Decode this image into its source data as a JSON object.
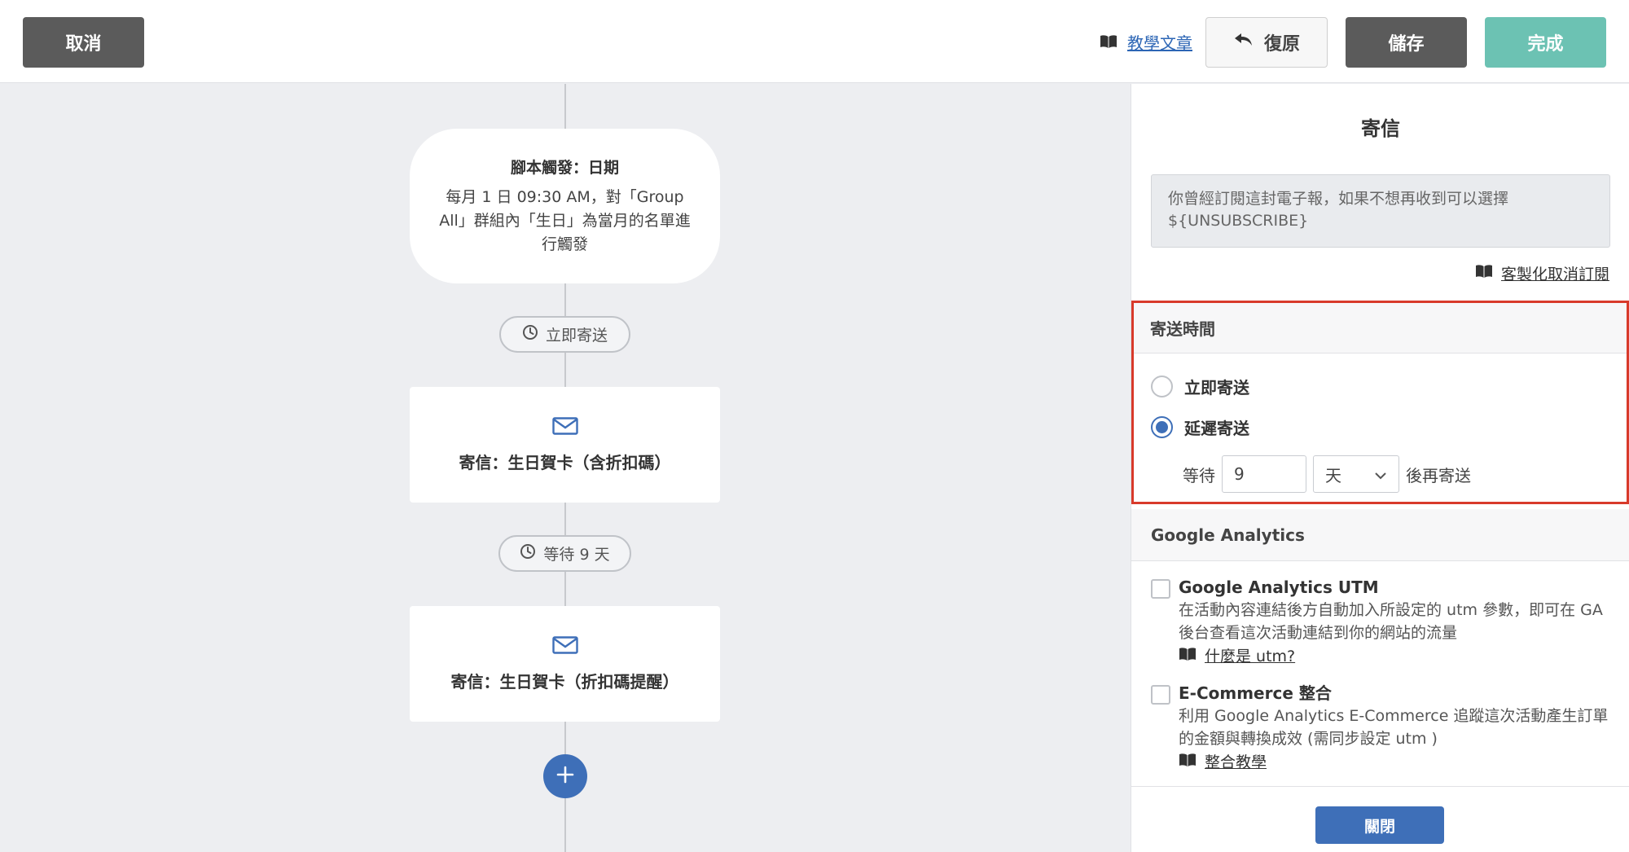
{
  "toolbar": {
    "cancel_label": "取消",
    "tutorial_label": "教學文章",
    "restore_label": "復原",
    "save_label": "儲存",
    "done_label": "完成"
  },
  "flow": {
    "trigger": {
      "title": "腳本觸發：日期",
      "description": "每月 1 日 09:30 AM，對「Group All」群組內「生日」為當月的名單進行觸發"
    },
    "steps": [
      {
        "type": "delay",
        "label": "立即寄送",
        "icon": "clock-icon"
      },
      {
        "type": "email",
        "label": "寄信：生日賀卡（含折扣碼）",
        "icon": "envelope-icon"
      },
      {
        "type": "delay",
        "label": "等待 9 天",
        "icon": "clock-icon"
      },
      {
        "type": "email",
        "label": "寄信：生日賀卡（折扣碼提醒）",
        "icon": "envelope-icon"
      }
    ],
    "add_icon": "plus-icon"
  },
  "panel": {
    "title": "寄信",
    "unsubscribe_text": "你曾經訂閱這封電子報，如果不想再收到可以選擇 ${UNSUBSCRIBE}",
    "custom_unsubscribe_link": "客製化取消訂閱",
    "send_time": {
      "header": "寄送時間",
      "options": [
        {
          "label": "立即寄送",
          "checked": false
        },
        {
          "label": "延遲寄送",
          "checked": true
        }
      ],
      "wait_label": "等待",
      "wait_value": "9",
      "unit_value": "天",
      "after_label": "後再寄送"
    },
    "google_analytics": {
      "header": "Google Analytics",
      "items": [
        {
          "title": "Google Analytics UTM",
          "description": "在活動內容連結後方自動加入所設定的 utm 參數，即可在 GA 後台查看這次活動連結到你的網站的流量",
          "link": "什麼是 utm?",
          "checked": false
        },
        {
          "title": "E-Commerce 整合",
          "description": "利用 Google Analytics E-Commerce 追蹤這次活動產生訂單的金額與轉換成效 (需同步設定 utm )",
          "link": "整合教學",
          "checked": false
        }
      ]
    },
    "close_label": "關閉"
  },
  "colors": {
    "accent_blue": "#3e6fb8",
    "done_green": "#6cc2b3",
    "dark_button": "#5b5b5b",
    "highlight_red": "#d83a2b",
    "canvas_bg": "#edeef1"
  }
}
